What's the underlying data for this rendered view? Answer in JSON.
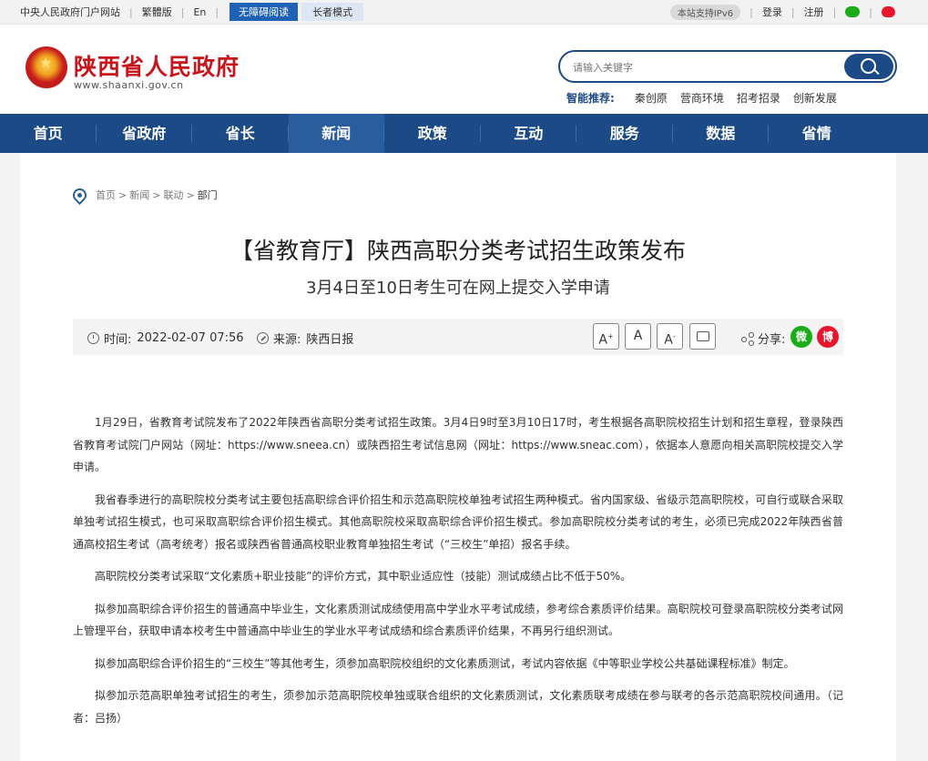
{
  "topbar": {
    "gov_portal": "中央人民政府门户网站",
    "traditional": "繁體版",
    "english": "En",
    "accessible": "无障碍阅读",
    "elder_mode": "长者模式",
    "ipv6": "本站支持IPv6",
    "login": "登录",
    "register": "注册"
  },
  "header": {
    "site_name": "陕西省人民政府",
    "site_url": "www.shaanxi.gov.cn",
    "search_placeholder": "请输入关键字",
    "smart_label": "智能推荐:",
    "smart_items": [
      "秦创原",
      "营商环境",
      "招考招录",
      "创新发展"
    ]
  },
  "nav": {
    "items": [
      "首页",
      "省政府",
      "省长",
      "新闻",
      "政策",
      "互动",
      "服务",
      "数据",
      "省情"
    ],
    "active": "新闻"
  },
  "breadcrumb": [
    "首页",
    "新闻",
    "联动",
    "部门"
  ],
  "article": {
    "title": "【省教育厅】陕西高职分类考试招生政策发布",
    "subtitle": "3月4日至10日考生可在网上提交入学申请",
    "time_label": "时间:",
    "time_value": "2022-02-07 07:56",
    "source_label": "来源:",
    "source_value": "陕西日报",
    "share_label": "分享:",
    "paragraphs": [
      "1月29日，省教育考试院发布了2022年陕西省高职分类考试招生政策。3月4日9时至3月10日17时，考生根据各高职院校招生计划和招生章程，登录陕西省教育考试院门户网站（网址：https://www.sneea.cn）或陕西招生考试信息网（网址：https://www.sneac.com），依据本人意愿向相关高职院校提交入学申请。",
      "我省春季进行的高职院校分类考试主要包括高职综合评价招生和示范高职院校单独考试招生两种模式。省内国家级、省级示范高职院校，可自行或联合采取单独考试招生模式，也可采取高职综合评价招生模式。其他高职院校采取高职综合评价招生模式。参加高职院校分类考试的考生，必须已完成2022年陕西省普通高校招生考试（高考统考）报名或陕西省普通高校职业教育单独招生考试（“三校生”单招）报名手续。",
      "高职院校分类考试采取“文化素质+职业技能”的评价方式，其中职业适应性（技能）测试成绩占比不低于50%。",
      "拟参加高职综合评价招生的普通高中毕业生，文化素质测试成绩使用高中学业水平考试成绩，参考综合素质评价结果。高职院校可登录高职院校分类考试网上管理平台，获取申请本校考生中普通高中毕业生的学业水平考试成绩和综合素质评价结果，不再另行组织测试。",
      "拟参加高职综合评价招生的“三校生”等其他考生，须参加高职院校组织的文化素质测试，考试内容依据《中等职业学校公共基础课程标准》制定。",
      "拟参加示范高职单独考试招生的考生，须参加示范高职院校单独或联合组织的文化素质测试，文化素质联考成绩在参与联考的各示范高职院校间通用。（记者：吕扬）"
    ]
  },
  "colors": {
    "nav_bg": "#1c4a86",
    "brand_red": "#c8161d",
    "wechat_green": "#1aad19",
    "weibo_red": "#e6162d"
  }
}
